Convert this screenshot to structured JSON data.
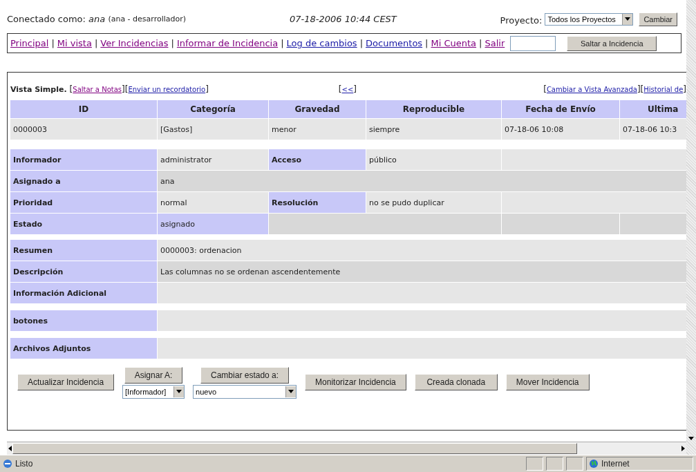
{
  "header": {
    "connected_label": "Conectado como:",
    "user": "ana",
    "role": "(ana - desarrollador)",
    "datetime": "07-18-2006 10:44 CEST",
    "project_label": "Proyecto:",
    "project_select": "Todos los Proyectos",
    "change_button": "Cambiar"
  },
  "nav": {
    "separator": "|",
    "links": [
      {
        "label": "Principal",
        "visited": true
      },
      {
        "label": "Mi vista",
        "visited": true
      },
      {
        "label": "Ver Incidencias",
        "visited": true
      },
      {
        "label": "Informar de Incidencia",
        "visited": true
      },
      {
        "label": "Log de cambios",
        "visited": false
      },
      {
        "label": "Documentos",
        "visited": false
      },
      {
        "label": "Mi Cuenta",
        "visited": true
      },
      {
        "label": "Salir",
        "visited": true
      }
    ],
    "jump_button": "Saltar a Incidencia"
  },
  "view_bar": {
    "title": "Vista Simple.",
    "open_bracket": "[",
    "close_bracket": "]",
    "left_links": [
      {
        "label": "Saltar a Notas",
        "visited": true
      },
      {
        "label": "Enviar un recordatorio",
        "visited": false
      }
    ],
    "center_links": [
      {
        "label": "<<",
        "visited": false
      }
    ],
    "right_links": [
      {
        "label": "Cambiar a Vista Avanzada",
        "visited": false
      },
      {
        "label": "Historial de",
        "visited": false
      }
    ]
  },
  "table": {
    "columns": [
      "ID",
      "Categoría",
      "Gravedad",
      "Reproducible",
      "Fecha de Envío",
      "Ultima"
    ],
    "row": [
      "0000003",
      "[Gastos]",
      "menor",
      "siempre",
      "07-18-06 10:08",
      "07-18-06 10:3"
    ]
  },
  "details": [
    [
      {
        "cells": [
          {
            "kind": "label",
            "text": "Informador"
          },
          {
            "kind": "value",
            "text": "administrator"
          },
          {
            "kind": "label",
            "text": "Acceso"
          },
          {
            "kind": "value",
            "text": "público"
          },
          {
            "kind": "empty"
          }
        ]
      },
      {
        "cells": [
          {
            "kind": "label",
            "text": "Asignado a"
          },
          {
            "kind": "value",
            "text": "ana"
          }
        ]
      },
      {
        "cells": [
          {
            "kind": "label",
            "text": "Prioridad"
          },
          {
            "kind": "value",
            "text": "normal"
          },
          {
            "kind": "label",
            "text": "Resolución"
          },
          {
            "kind": "value",
            "text": "no se pudo duplicar"
          },
          {
            "kind": "empty"
          }
        ]
      },
      {
        "cells": [
          {
            "kind": "label",
            "text": "Estado"
          },
          {
            "kind": "highlight",
            "text": "asignado"
          },
          {
            "kind": "wide_empty"
          },
          {
            "kind": "empty"
          },
          {
            "kind": "empty"
          }
        ]
      }
    ],
    [
      {
        "cells": [
          {
            "kind": "label",
            "text": "Resumen"
          },
          {
            "kind": "value",
            "text": "0000003: ordenacion"
          }
        ]
      },
      {
        "cells": [
          {
            "kind": "label",
            "text": "Descripción"
          },
          {
            "kind": "value",
            "text": "Las columnas no se ordenan ascendentemente"
          }
        ]
      },
      {
        "cells": [
          {
            "kind": "label",
            "text": "Información Adicional"
          },
          {
            "kind": "empty"
          }
        ]
      }
    ],
    [
      {
        "cells": [
          {
            "kind": "label",
            "text": "botones"
          },
          {
            "kind": "empty"
          }
        ]
      }
    ],
    [
      {
        "cells": [
          {
            "kind": "label",
            "text": "Archivos Adjuntos"
          },
          {
            "kind": "empty"
          }
        ]
      }
    ]
  ],
  "actions": [
    {
      "kind": "button",
      "label": "Actualizar Incidencia"
    },
    {
      "kind": "select_button",
      "label": "Asignar A:",
      "select": "[Informador]"
    },
    {
      "kind": "select_button",
      "label": "Cambiar estado a:",
      "select": "nuevo"
    },
    {
      "kind": "button",
      "label": "Monitorizar Incidencia"
    },
    {
      "kind": "button",
      "label": "Creada clonada"
    },
    {
      "kind": "button",
      "label": "Mover Incidencia"
    }
  ],
  "status_bar": {
    "text": "Listo",
    "zone": "Internet"
  }
}
